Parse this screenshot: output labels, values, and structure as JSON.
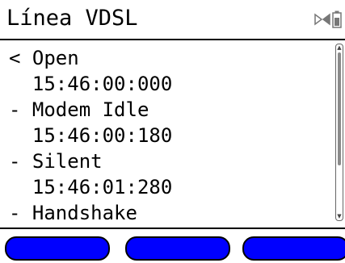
{
  "header": {
    "title": "Línea VDSL",
    "status_icons": [
      "connection-icon",
      "battery-icon"
    ]
  },
  "log": {
    "lines": [
      "< Open",
      "  15:46:00:000",
      "- Modem Idle",
      "  15:46:00:180",
      "- Silent",
      "  15:46:01:280",
      "- Handshake"
    ]
  },
  "scrollbar": {
    "up_glyph": "▲",
    "down_glyph": "▼"
  },
  "softkeys": {
    "labels": [
      "",
      "",
      ""
    ]
  },
  "colors": {
    "softkey": "#0000ff",
    "text": "#000000",
    "background": "#ffffff"
  }
}
